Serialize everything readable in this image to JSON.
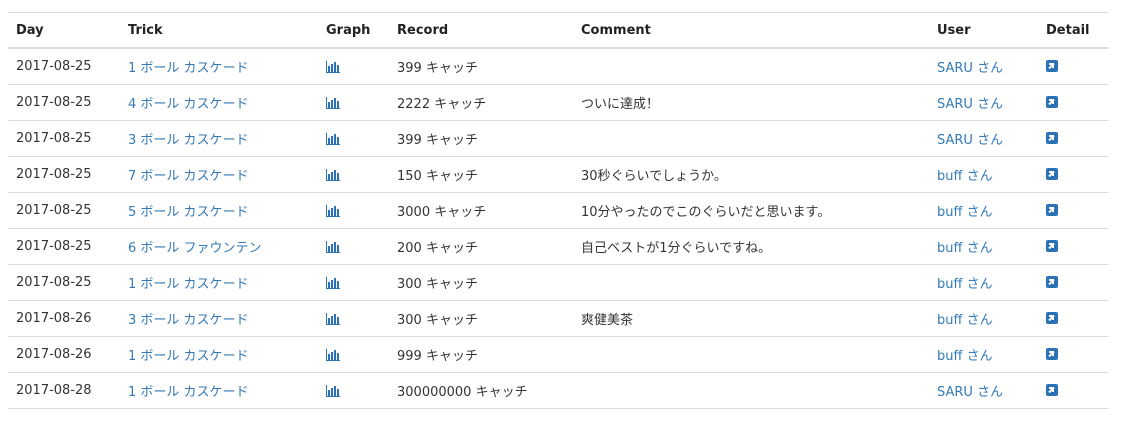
{
  "colors": {
    "link": "#337ab7",
    "border": "#dddddd",
    "text": "#333333",
    "icon": "#2a72b5"
  },
  "table": {
    "headers": {
      "day": "Day",
      "trick": "Trick",
      "graph": "Graph",
      "record": "Record",
      "comment": "Comment",
      "user": "User",
      "detail": "Detail"
    },
    "rows": [
      {
        "day": "2017-08-25",
        "trick": "1 ボール カスケード",
        "record": "399 キャッチ",
        "comment": "",
        "user": "SARU さん"
      },
      {
        "day": "2017-08-25",
        "trick": "4 ボール カスケード",
        "record": "2222 キャッチ",
        "comment": "ついに達成！",
        "user": "SARU さん"
      },
      {
        "day": "2017-08-25",
        "trick": "3 ボール カスケード",
        "record": "399 キャッチ",
        "comment": "",
        "user": "SARU さん"
      },
      {
        "day": "2017-08-25",
        "trick": "7 ボール カスケード",
        "record": "150 キャッチ",
        "comment": "30秒ぐらいでしょうか。",
        "user": "buff さん"
      },
      {
        "day": "2017-08-25",
        "trick": "5 ボール カスケード",
        "record": "3000 キャッチ",
        "comment": "10分やったのでこのぐらいだと思います。",
        "user": "buff さん"
      },
      {
        "day": "2017-08-25",
        "trick": "6 ボール ファウンテン",
        "record": "200 キャッチ",
        "comment": "自己ベストが1分ぐらいですね。",
        "user": "buff さん"
      },
      {
        "day": "2017-08-25",
        "trick": "1 ボール カスケード",
        "record": "300 キャッチ",
        "comment": "",
        "user": "buff さん"
      },
      {
        "day": "2017-08-26",
        "trick": "3 ボール カスケード",
        "record": "300 キャッチ",
        "comment": "爽健美茶",
        "user": "buff さん"
      },
      {
        "day": "2017-08-26",
        "trick": "1 ボール カスケード",
        "record": "999 キャッチ",
        "comment": "",
        "user": "buff さん"
      },
      {
        "day": "2017-08-28",
        "trick": "1 ボール カスケード",
        "record": "300000000 キャッチ",
        "comment": "",
        "user": "SARU さん"
      }
    ],
    "icons": {
      "graph": "bar-chart-icon",
      "detail": "external-link-icon"
    }
  }
}
